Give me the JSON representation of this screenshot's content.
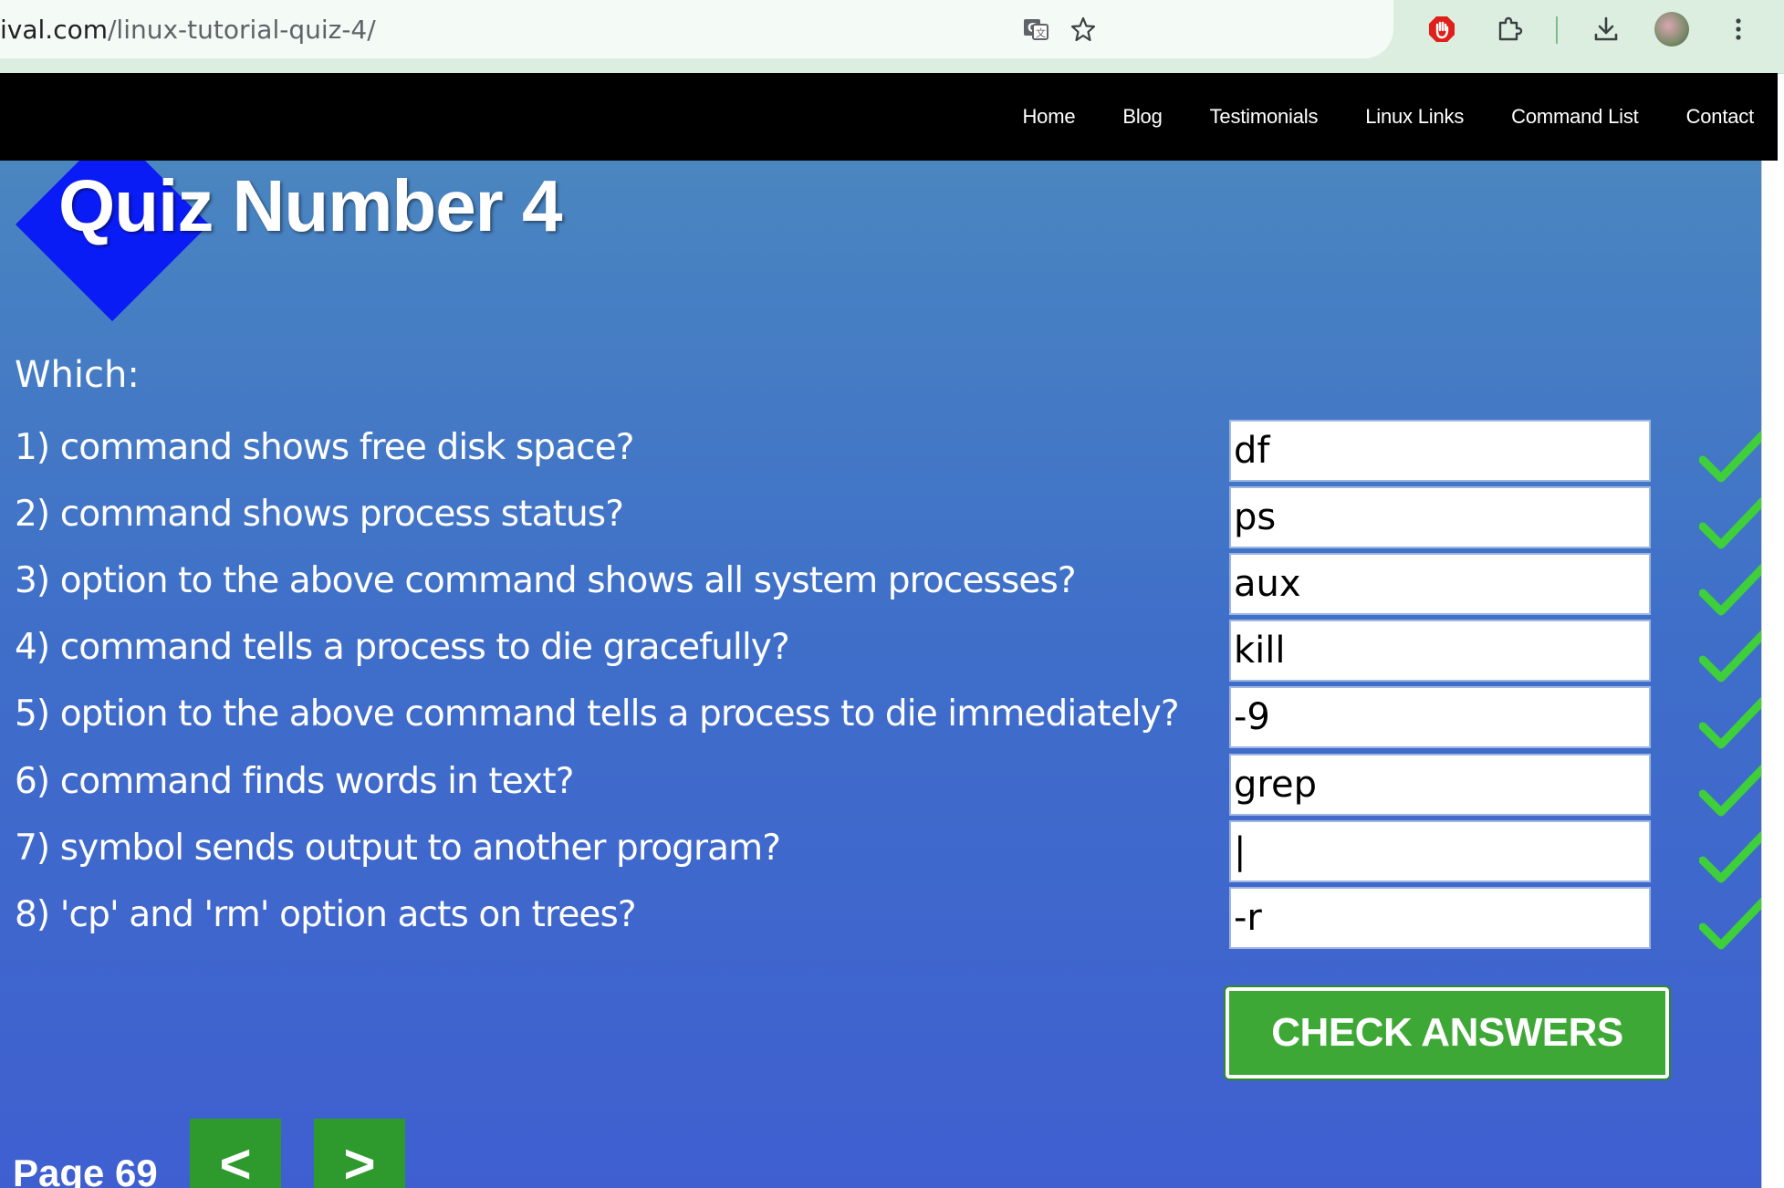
{
  "browser": {
    "url_host": "ival.com",
    "url_path": "/linux-tutorial-quiz-4/"
  },
  "nav": {
    "links": [
      "Home",
      "Blog",
      "Testimonials",
      "Linux Links",
      "Command List",
      "Contact"
    ]
  },
  "quiz": {
    "title": "Quiz Number 4",
    "intro": "Which:",
    "questions": [
      {
        "text": "1) command shows free disk space?",
        "answer": "df",
        "correct": true
      },
      {
        "text": "2) command shows process status?",
        "answer": "ps",
        "correct": true
      },
      {
        "text": "3) option to the above command shows all system processes?",
        "answer": "aux",
        "correct": true
      },
      {
        "text": "4) command tells a process to die gracefully?",
        "answer": "kill",
        "correct": true
      },
      {
        "text": "5) option to the above command tells a process to die immediately?",
        "answer": "-9",
        "correct": true
      },
      {
        "text": "6) command finds words in text?",
        "answer": "grep",
        "correct": true
      },
      {
        "text": "7) symbol sends output to another program?",
        "answer": "|",
        "correct": true
      },
      {
        "text": "8) 'cp' and 'rm' option acts on trees?",
        "answer": "-r",
        "correct": true
      }
    ],
    "check_label": "CHECK ANSWERS"
  },
  "pager": {
    "label": "Page 69",
    "prev": "<",
    "next": ">"
  },
  "colors": {
    "check_button": "#3ea837",
    "check_mark": "#3ecf3a",
    "nav_bg": "#000000"
  }
}
